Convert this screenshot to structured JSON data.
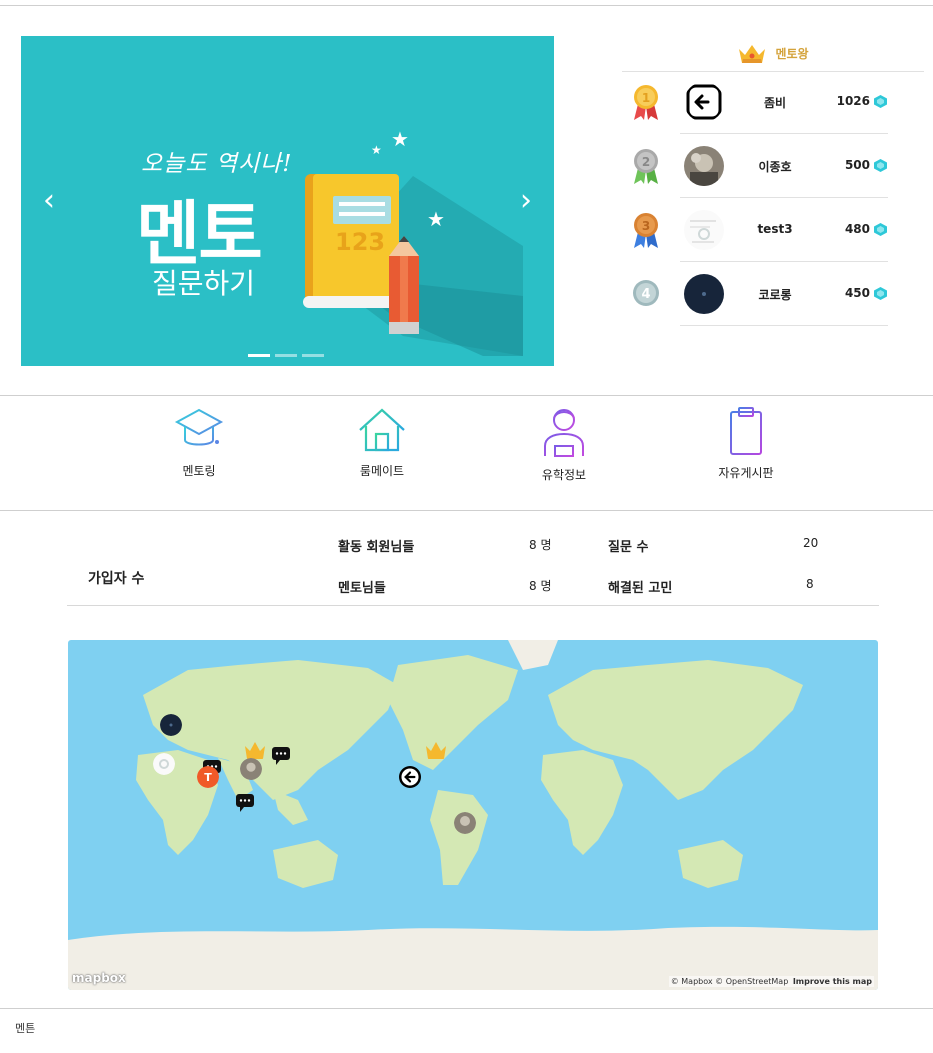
{
  "banner": {
    "tagline": "오늘도 역시나!",
    "title": "멘토",
    "subtitle": "질문하기",
    "book_number": "123",
    "prev_icon": "chevron-left",
    "next_icon": "chevron-right",
    "slide_count": 3,
    "active_slide": 1
  },
  "ranking": {
    "title": "멘토왕",
    "items": [
      {
        "rank": "1",
        "name": "좀비",
        "score": "1026"
      },
      {
        "rank": "2",
        "name": "이종호",
        "score": "500"
      },
      {
        "rank": "3",
        "name": "test3",
        "score": "480"
      },
      {
        "rank": "4",
        "name": "코로롱",
        "score": "450"
      }
    ]
  },
  "nav": {
    "items": [
      {
        "label": "멘토링",
        "icon": "graduation-cap-icon"
      },
      {
        "label": "룸메이트",
        "icon": "house-icon"
      },
      {
        "label": "유학정보",
        "icon": "student-icon"
      },
      {
        "label": "자유게시판",
        "icon": "clipboard-icon"
      }
    ]
  },
  "stats": {
    "total_label": "가입자 수",
    "active_members_label": "활동 회원님들",
    "active_members_value": "8 명",
    "mentors_label": "멘토님들",
    "mentors_value": "8 명",
    "questions_label": "질문 수",
    "questions_value": "20",
    "solved_label": "해결된 고민",
    "solved_value": "8"
  },
  "map": {
    "logo": "mapbox",
    "attribution": "© Mapbox © OpenStreetMap",
    "improve": "Improve this map"
  },
  "footer": {
    "text": "멘튼"
  },
  "colors": {
    "banner_bg": "#2bbfc6",
    "accent_gold": "#d4a33b",
    "gem": "#2ec8d8",
    "ocean": "#7fd0f1",
    "land": "#d4e8b4"
  }
}
